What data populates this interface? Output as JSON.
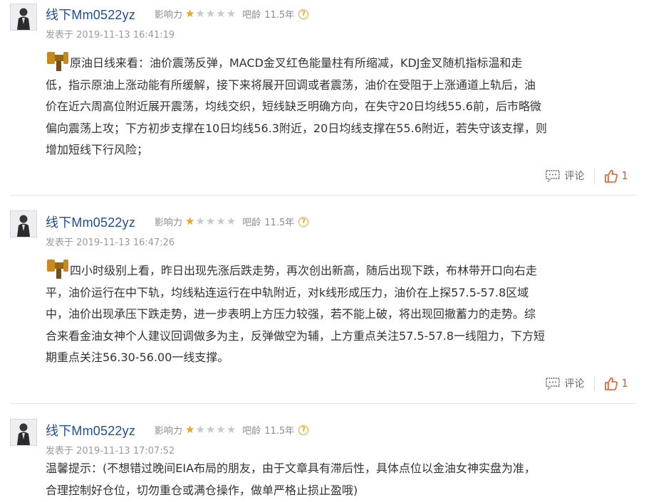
{
  "posts": [
    {
      "username": "线下Mm0522yz",
      "influence_label": "影响力",
      "influence_stars": 1,
      "bar_age_label": "吧龄",
      "bar_age_value": "11.5年",
      "posted_at": "发表于 2019-11-13 16:41:19",
      "lines": [
        "原油日线来看：油价震荡反弹，MACD金叉红色能量柱有所缩减，KDJ金叉随机指标温和走",
        "低，指示原油上涨动能有所缓解，接下来将展开回调或者震荡，油价在受阻于上涨通道上轨后，油",
        "价在近六周高位附近展开震荡，均线交织，短线缺乏明确方向，在失守20日均线55.6前，后市略微",
        "偏向震荡上攻；下方初步支撑在10日均线56.3附近，20日均线支撑在55.6附近，若失守该支撑，则",
        "增加短线下行风险；"
      ],
      "comment_label": "评论",
      "like_count": "1"
    },
    {
      "username": "线下Mm0522yz",
      "influence_label": "影响力",
      "influence_stars": 1,
      "bar_age_label": "吧龄",
      "bar_age_value": "11.5年",
      "posted_at": "发表于 2019-11-13 16:47:26",
      "lines": [
        "四小时级别上看，昨日出现先涨后跌走势，再次创出新高，随后出现下跌，布林带开口向右走",
        "平，油价运行在中下轨，均线粘连运行在中轨附近，对k线形成压力，油价在上探57.5-57.8区域",
        "中，油价出现承压下跌走势，进一步表明上方压力较强，若不能上破，将出现回撤蓄力的走势。综",
        "合来看金油女神个人建议回调做多为主，反弹做空为辅，上方重点关注57.5-57.8一线阻力，下方短",
        "期重点关注56.30-56.00一线支撑。"
      ],
      "comment_label": "评论",
      "like_count": "1"
    },
    {
      "username": "线下Mm0522yz",
      "influence_label": "影响力",
      "influence_stars": 1,
      "bar_age_label": "吧龄",
      "bar_age_value": "11.5年",
      "posted_at": "发表于 2019-11-13 17:07:52",
      "lines": [
        "温馨提示：(不想错过晚间EIA布局的朋友，由于文章具有滞后性，具体点位以金油女神实盘为准，",
        "合理控制好仓位，切勿重仓或满仓操作，做单严格止损止盈哦)"
      ]
    }
  ],
  "colors": {
    "username": "#1f4d99",
    "star_on": "#f3a01b",
    "like": "#e8591a"
  }
}
